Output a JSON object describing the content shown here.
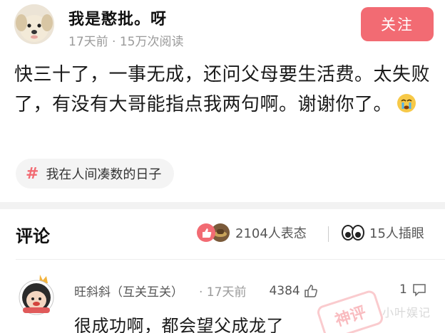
{
  "post": {
    "author": "我是憨批。呀",
    "meta": "17天前 · 15万次阅读",
    "follow_label": "关注",
    "body": "快三十了，一事无成，还问父母要生活费。太失败了，有没有大哥能指点我两句啊。谢谢你了。",
    "topic_icon": "hash-icon",
    "topic": "我在人间凑数的日子"
  },
  "comments_section": {
    "title": "评论",
    "reactions_count": "2104人表态",
    "watchers_count": "15人插眼"
  },
  "comment": {
    "author": "旺斜斜（互关互关）",
    "time": "· 17天前",
    "likes": "4384",
    "replies": "1",
    "text": "很成功啊，都会望父成龙了",
    "stamp": "神评"
  },
  "watermark": "小叶娱记",
  "colors": {
    "accent": "#f26b73",
    "meta_gray": "#9a9a9a",
    "divider": "#f2f2f2"
  }
}
